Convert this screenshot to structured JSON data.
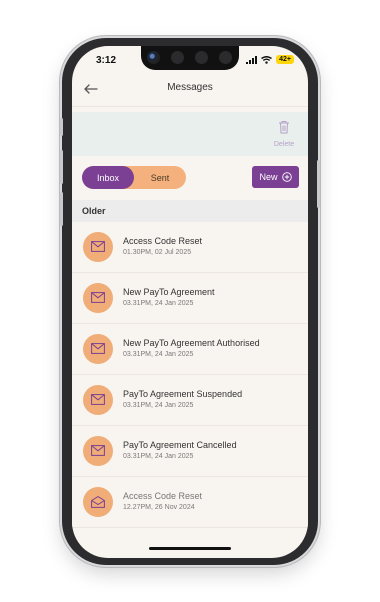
{
  "status_bar": {
    "time": "3:12",
    "battery": "42+"
  },
  "header": {
    "title": "Messages"
  },
  "toolbar": {
    "delete_label": "Delete"
  },
  "tabs": {
    "inbox_label": "Inbox",
    "sent_label": "Sent",
    "active": "Inbox"
  },
  "new_button": {
    "label": "New"
  },
  "section": {
    "label": "Older"
  },
  "messages": [
    {
      "subject": "Access Code Reset",
      "date": "01.30PM, 02 Jul 2025",
      "read": false
    },
    {
      "subject": "New PayTo Agreement",
      "date": "03.31PM, 24 Jan 2025",
      "read": false
    },
    {
      "subject": "New PayTo Agreement Authorised",
      "date": "03.31PM, 24 Jan 2025",
      "read": false
    },
    {
      "subject": "PayTo Agreement Suspended",
      "date": "03.31PM, 24 Jan 2025",
      "read": false
    },
    {
      "subject": "PayTo Agreement Cancelled",
      "date": "03.31PM, 24 Jan 2025",
      "read": false
    },
    {
      "subject": "Access Code Reset",
      "date": "12.27PM, 26 Nov 2024",
      "read": true
    }
  ],
  "colors": {
    "accent": "#7b3f94",
    "orange": "#f5b17d",
    "avatar": "#f0ad78",
    "background": "#f8f4ef"
  },
  "icons": [
    "back-arrow-icon",
    "trash-icon",
    "plus-circle-icon",
    "envelope-icon",
    "envelope-open-icon"
  ]
}
